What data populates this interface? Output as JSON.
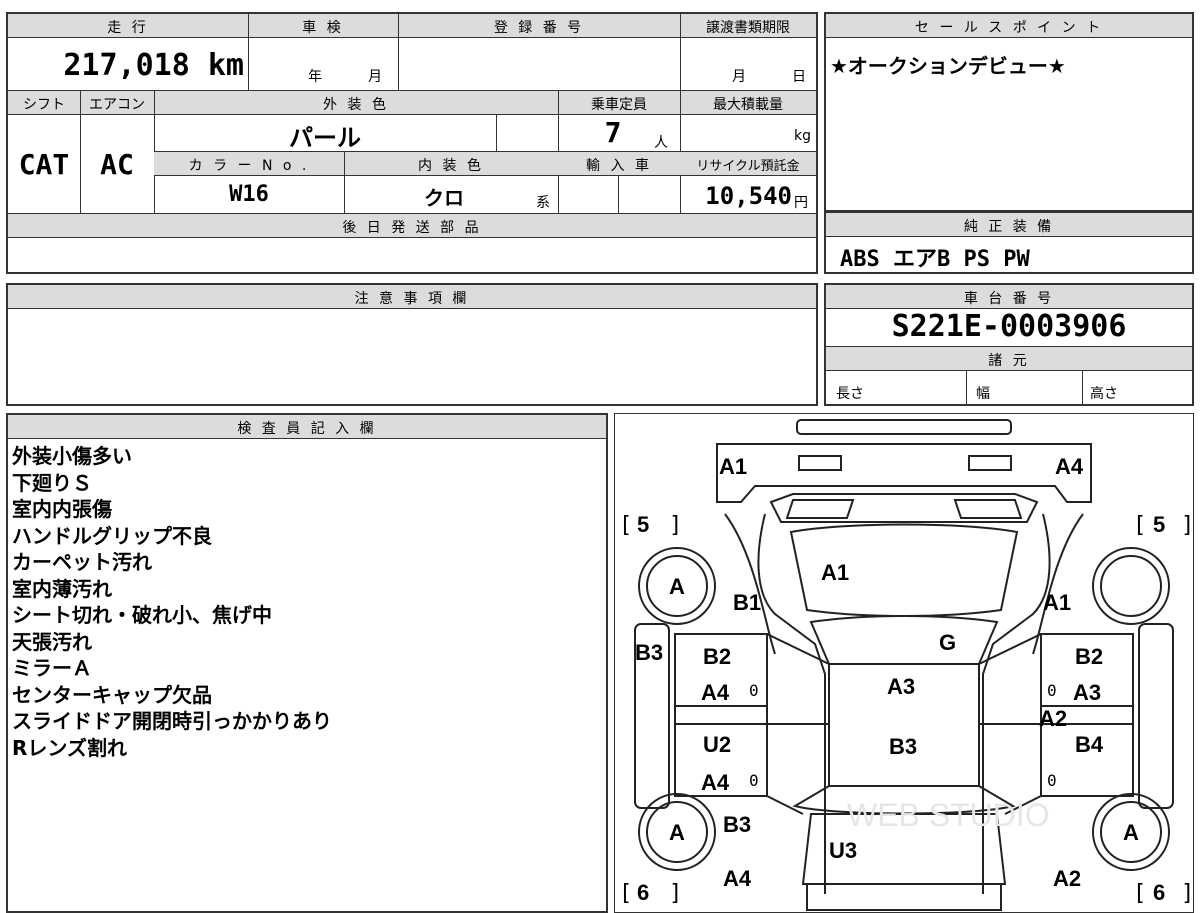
{
  "top": {
    "mileage_label": "走 行",
    "mileage_value": "217,018 km",
    "inspection_label": "車 検",
    "inspection_year": "年",
    "inspection_month": "月",
    "registration_label": "登 録 番 号",
    "transfer_label": "譲渡書類期限",
    "transfer_month": "月",
    "transfer_day": "日",
    "shift_label": "シフト",
    "shift_value": "CAT",
    "ac_label": "エアコン",
    "ac_value": "AC",
    "exterior_color_label": "外 装 色",
    "exterior_color_value": "パール",
    "color_no_label": "カ ラ ー N o .",
    "color_no_value": "W16",
    "interior_color_label": "内 装 色",
    "interior_color_value": "クロ",
    "interior_suffix": "系",
    "capacity_label": "乗車定員",
    "capacity_value": "7",
    "capacity_unit": "人",
    "import_label": "輸 入 車",
    "max_load_label": "最大積載量",
    "max_load_unit": "kg",
    "recycle_label": "リサイクル預託金",
    "recycle_value": "10,540",
    "recycle_unit": "円",
    "later_parts_label": "後 日 発 送 部 品"
  },
  "sales_point": {
    "label": "セ ー ル ス ポ イ ン ト",
    "text": "★オークションデビュー★"
  },
  "equipment": {
    "label": "純 正 装 備",
    "text": "ABS エアB PS PW"
  },
  "caution": {
    "label": "注 意 事 項 欄"
  },
  "chassis": {
    "label": "車 台 番 号",
    "value": "S221E-0003906",
    "specs_label": "諸 元",
    "length_label": "長さ",
    "width_label": "幅",
    "height_label": "高さ"
  },
  "inspector": {
    "label": "検 査 員 記 入 欄",
    "lines": [
      "外装小傷多い",
      "下廻りＳ",
      "室内内張傷",
      "ハンドルグリップ不良",
      "カーペット汚れ",
      "室内薄汚れ",
      "シート切れ・破れ小、焦げ中",
      "天張汚れ",
      "ミラーＡ",
      "センターキャップ欠品",
      "スライドドア開閉時引っかかりあり",
      "Rレンズ割れ"
    ]
  },
  "diagram": {
    "front_left_bumper": "A1",
    "front_right_bumper": "A4",
    "bracket_left_top": "5",
    "bracket_right_top": "5",
    "bracket_left_bottom": "6",
    "bracket_right_bottom": "6",
    "wheel_front_left": "A",
    "wheel_rear_left": "A",
    "wheel_rear_right": "A",
    "left_fender": "B1",
    "hood": "A1",
    "right_fender": "A1",
    "left_rocker": "B3",
    "roof_front": "G",
    "left_front_door_1": "B2",
    "left_front_door_2": "A4",
    "roof": "A3",
    "right_front_door_1": "B2",
    "right_front_door_2": "A3",
    "right_mid": "A2",
    "left_rear_door_1": "U2",
    "left_rear_door_2": "A4",
    "roof_rear": "B3",
    "right_rear_door": "B4",
    "left_rear_quarter": "B3",
    "back_door": "U3",
    "left_rear_bumper": "A4",
    "right_rear_bumper": "A2",
    "handle_mark": "0",
    "watermark": "WEB STUDIO"
  }
}
